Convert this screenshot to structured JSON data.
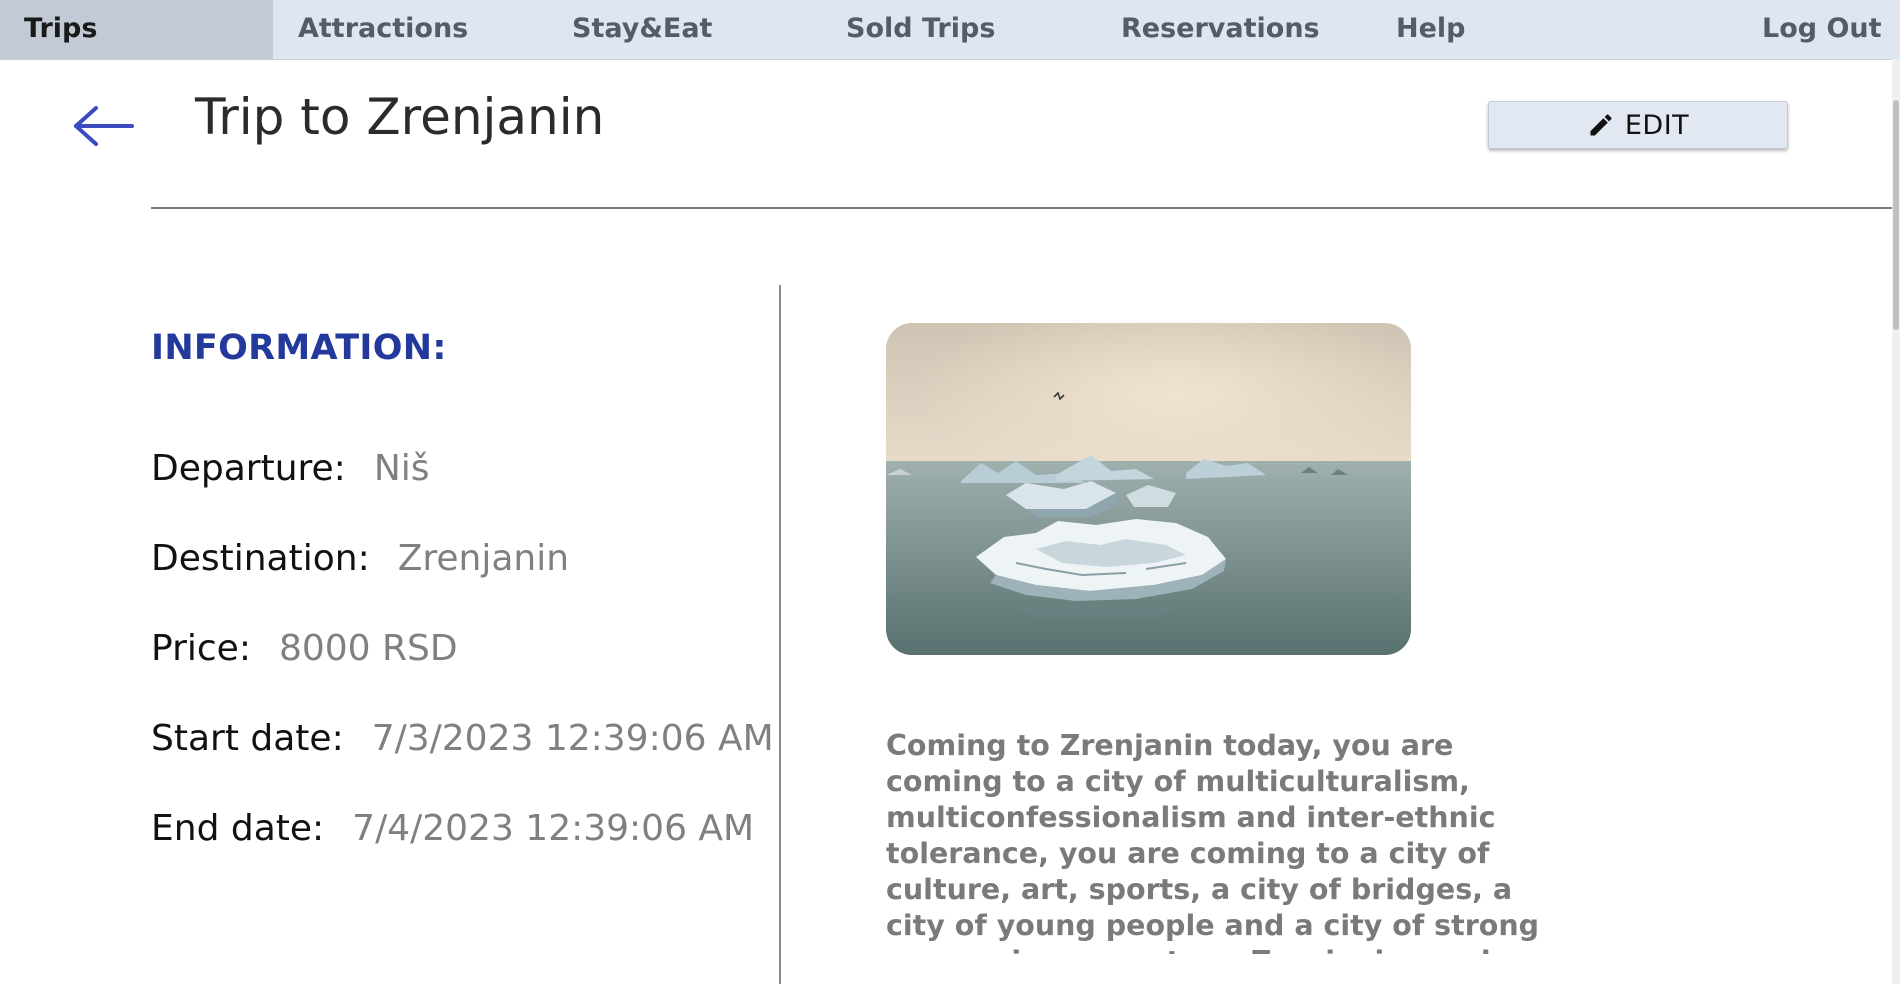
{
  "nav": {
    "items": [
      {
        "label": "Trips",
        "active": true
      },
      {
        "label": "Attractions"
      },
      {
        "label": "Stay&Eat"
      },
      {
        "label": "Sold Trips"
      },
      {
        "label": "Reservations"
      },
      {
        "label": "Help"
      },
      {
        "label": "Log Out"
      }
    ]
  },
  "header": {
    "back_icon": "arrow-left-icon",
    "title": "Trip to Zrenjanin",
    "edit_icon": "pencil-icon",
    "edit_label": "EDIT"
  },
  "info": {
    "heading": "INFORMATION:",
    "rows": [
      {
        "label": "Departure:",
        "value": "Niš"
      },
      {
        "label": "Destination:",
        "value": "Zrenjanin"
      },
      {
        "label": "Price:",
        "value": "8000 RSD"
      },
      {
        "label": "Start date:",
        "value": "7/3/2023 12:39:06 AM"
      },
      {
        "label": "End date:",
        "value": "7/4/2023 12:39:06 AM"
      }
    ]
  },
  "description": "Coming to Zrenjanin today, you are coming to a city of multiculturalism, multiconfessionalism and inter-ethnic tolerance, you are coming to a city of culture, art, sports, a city of bridges, a city of young people and a city of strong economic momentum. Zrenjanin can be recognized by",
  "colors": {
    "nav_bg": "#dfe6f1",
    "nav_active_bg": "#c2cad6",
    "accent": "#233a9c",
    "back_arrow": "#3b4cc0",
    "muted_text": "#808080"
  }
}
